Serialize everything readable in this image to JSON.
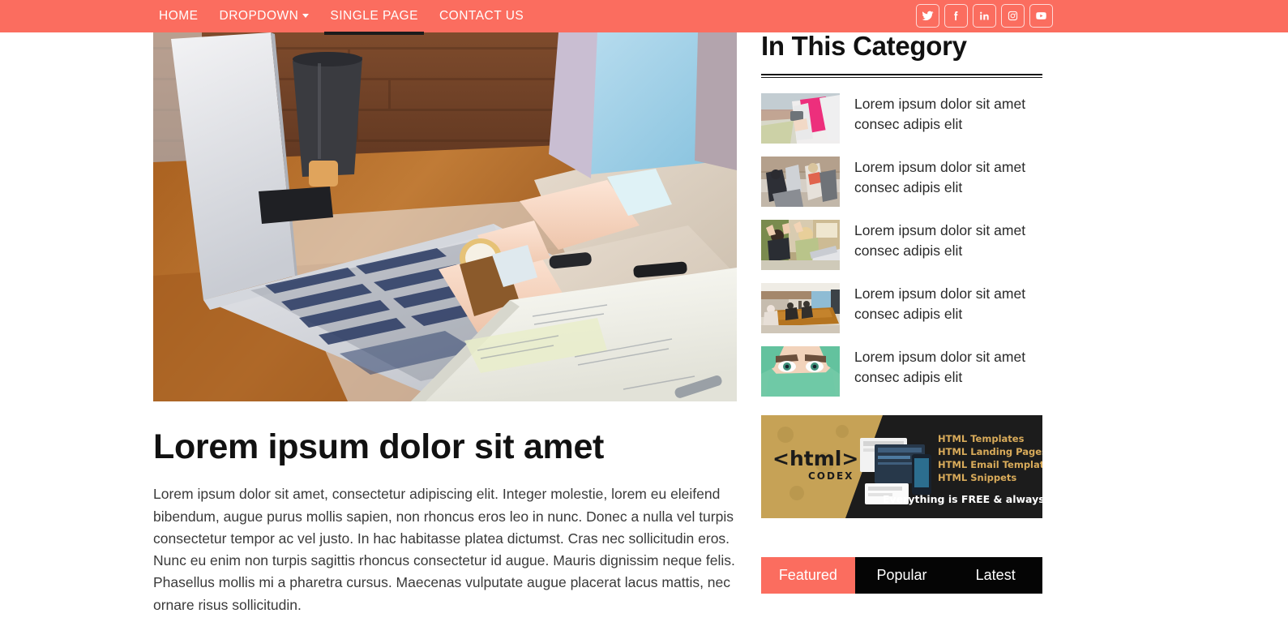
{
  "navbar": {
    "brand_color": "#fb6d5f",
    "links": [
      {
        "label": "HOME",
        "active": false,
        "has_caret": false
      },
      {
        "label": "DROPDOWN",
        "active": false,
        "has_caret": true
      },
      {
        "label": "SINGLE PAGE",
        "active": true,
        "has_caret": false
      },
      {
        "label": "CONTACT US",
        "active": false,
        "has_caret": false
      }
    ],
    "social": [
      {
        "name": "twitter",
        "label": "Twitter"
      },
      {
        "name": "facebook",
        "label": "Facebook"
      },
      {
        "name": "linkedin",
        "label": "LinkedIn"
      },
      {
        "name": "instagram",
        "label": "Instagram"
      },
      {
        "name": "youtube",
        "label": "YouTube"
      }
    ]
  },
  "article": {
    "hero_alt": "Person typing on a laptop at a wooden desk with coffee cup and notebook",
    "title": "Lorem ipsum dolor sit amet",
    "body": "Lorem ipsum dolor sit amet, consectetur adipiscing elit. Integer molestie, lorem eu eleifend bibendum, augue purus mollis sapien, non rhoncus eros leo in nunc. Donec a nulla vel turpis consectetur tempor ac vel justo. In hac habitasse platea dictumst. Cras nec sollicitudin eros. Nunc eu enim non turpis sagittis rhoncus consectetur id augue. Mauris dignissim neque felis. Phasellus mollis mi a pharetra cursus. Maecenas vulputate augue placerat lacus mattis, nec ornare risus sollicitudin."
  },
  "sidebar": {
    "heading": "In This Category",
    "items": [
      {
        "text": "Lorem ipsum dolor sit amet consec adipis elit",
        "thumb": "woman-in-pink-sports-bra-with-phone"
      },
      {
        "text": "Lorem ipsum dolor sit amet consec adipis elit",
        "thumb": "two-women-exercising-in-gym"
      },
      {
        "text": "Lorem ipsum dolor sit amet consec adipis elit",
        "thumb": "people-cheering-at-laptop"
      },
      {
        "text": "Lorem ipsum dolor sit amet consec adipis elit",
        "thumb": "conference-room-meeting"
      },
      {
        "text": "Lorem ipsum dolor sit amet consec adipis elit",
        "thumb": "woman-with-green-headscarf"
      }
    ],
    "banner": {
      "logo_text": "<html>",
      "logo_sub": "CODEX",
      "features": [
        "HTML Templates",
        "HTML Landing Pages",
        "HTML Email Templates",
        "HTML Snippets"
      ],
      "tagline": "Everything is FREE & always will be",
      "gold_color": "#c6a256",
      "dark_color": "#1f1f1f",
      "accent_color": "#d9ab5a"
    },
    "tabs": [
      {
        "label": "Featured",
        "active": true
      },
      {
        "label": "Popular",
        "active": false
      },
      {
        "label": "Latest",
        "active": false
      }
    ]
  }
}
